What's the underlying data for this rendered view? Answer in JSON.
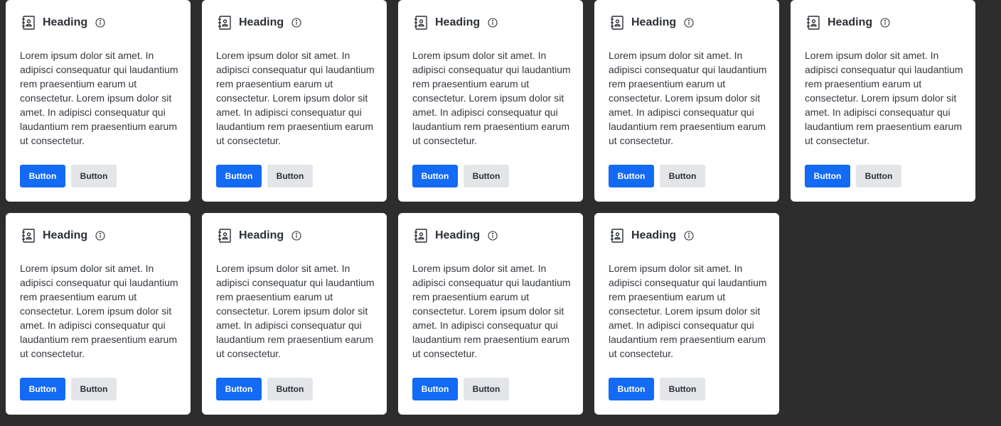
{
  "page": {
    "background": "#2d2d2d"
  },
  "theme": {
    "card_background": "#ffffff",
    "primary_color": "#136af4",
    "secondary_color": "#e3e5e8",
    "text_color": "#2b2f36"
  },
  "cards": [
    {
      "icon": "contact-book-icon",
      "heading": "Heading",
      "info_icon": "info-icon",
      "body": "Lorem ipsum dolor sit amet. In adipisci consequatur qui laudantium rem praesentium earum ut consectetur. Lorem ipsum dolor sit amet. In adipisci consequatur qui laudantium rem praesentium earum ut consectetur.",
      "primary_button": "Button",
      "secondary_button": "Button"
    },
    {
      "icon": "contact-book-icon",
      "heading": "Heading",
      "info_icon": "info-icon",
      "body": "Lorem ipsum dolor sit amet. In adipisci consequatur qui laudantium rem praesentium earum ut consectetur. Lorem ipsum dolor sit amet. In adipisci consequatur qui laudantium rem praesentium earum ut consectetur.",
      "primary_button": "Button",
      "secondary_button": "Button"
    },
    {
      "icon": "contact-book-icon",
      "heading": "Heading",
      "info_icon": "info-icon",
      "body": "Lorem ipsum dolor sit amet. In adipisci consequatur qui laudantium rem praesentium earum ut consectetur. Lorem ipsum dolor sit amet. In adipisci consequatur qui laudantium rem praesentium earum ut consectetur.",
      "primary_button": "Button",
      "secondary_button": "Button"
    },
    {
      "icon": "contact-book-icon",
      "heading": "Heading",
      "info_icon": "info-icon",
      "body": "Lorem ipsum dolor sit amet. In adipisci consequatur qui laudantium rem praesentium earum ut consectetur. Lorem ipsum dolor sit amet. In adipisci consequatur qui laudantium rem praesentium earum ut consectetur.",
      "primary_button": "Button",
      "secondary_button": "Button"
    },
    {
      "icon": "contact-book-icon",
      "heading": "Heading",
      "info_icon": "info-icon",
      "body": "Lorem ipsum dolor sit amet. In adipisci consequatur qui laudantium rem praesentium earum ut consectetur. Lorem ipsum dolor sit amet. In adipisci consequatur qui laudantium rem praesentium earum ut consectetur.",
      "primary_button": "Button",
      "secondary_button": "Button"
    },
    {
      "icon": "contact-book-icon",
      "heading": "Heading",
      "info_icon": "info-icon",
      "body": "Lorem ipsum dolor sit amet. In adipisci consequatur qui laudantium rem praesentium earum ut consectetur. Lorem ipsum dolor sit amet. In adipisci consequatur qui laudantium rem praesentium earum ut consectetur.",
      "primary_button": "Button",
      "secondary_button": "Button"
    },
    {
      "icon": "contact-book-icon",
      "heading": "Heading",
      "info_icon": "info-icon",
      "body": "Lorem ipsum dolor sit amet. In adipisci consequatur qui laudantium rem praesentium earum ut consectetur. Lorem ipsum dolor sit amet. In adipisci consequatur qui laudantium rem praesentium earum ut consectetur.",
      "primary_button": "Button",
      "secondary_button": "Button"
    },
    {
      "icon": "contact-book-icon",
      "heading": "Heading",
      "info_icon": "info-icon",
      "body": "Lorem ipsum dolor sit amet. In adipisci consequatur qui laudantium rem praesentium earum ut consectetur. Lorem ipsum dolor sit amet. In adipisci consequatur qui laudantium rem praesentium earum ut consectetur.",
      "primary_button": "Button",
      "secondary_button": "Button"
    },
    {
      "icon": "contact-book-icon",
      "heading": "Heading",
      "info_icon": "info-icon",
      "body": "Lorem ipsum dolor sit amet. In adipisci consequatur qui laudantium rem praesentium earum ut consectetur. Lorem ipsum dolor sit amet. In adipisci consequatur qui laudantium rem praesentium earum ut consectetur.",
      "primary_button": "Button",
      "secondary_button": "Button"
    }
  ]
}
